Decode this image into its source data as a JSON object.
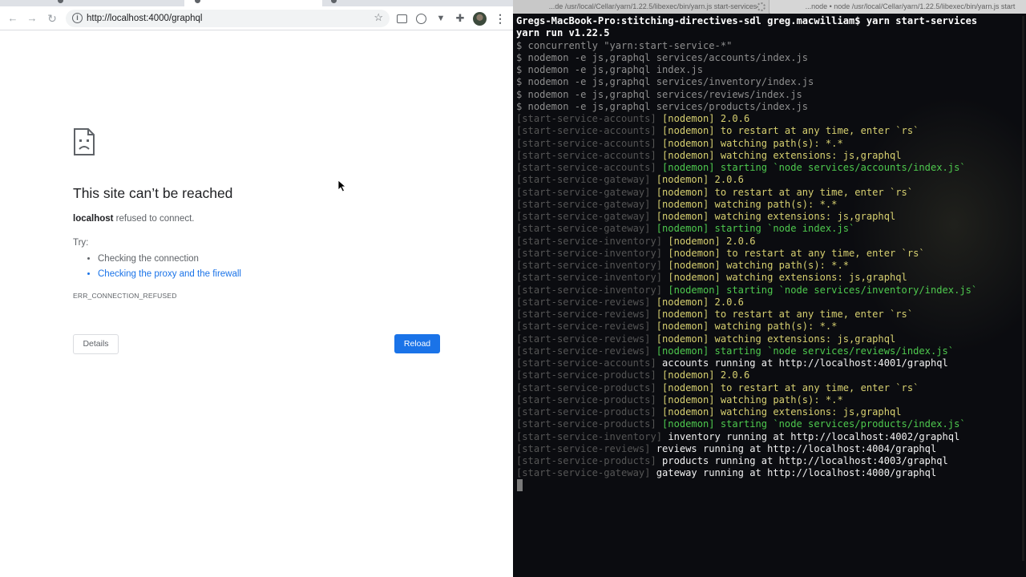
{
  "browser": {
    "address_url": "http://localhost:4000/graphql",
    "icons": [
      "back-arrow-icon",
      "forward-arrow-icon",
      "reload-icon",
      "info-icon",
      "star-icon",
      "extension-icon",
      "vpn-icon",
      "vue-devtools-icon",
      "puzzle-icon",
      "avatar",
      "menu-icon"
    ],
    "error": {
      "title": "This site can’t be reached",
      "host": "localhost",
      "message": " refused to connect.",
      "try_label": "Try:",
      "suggestions": [
        "Checking the connection",
        "Checking the proxy and the firewall"
      ],
      "code": "ERR_CONNECTION_REFUSED",
      "details_label": "Details",
      "reload_label": "Reload"
    }
  },
  "terminal": {
    "tabs": [
      "...de /usr/local/Cellar/yarn/1.22.5/libexec/bin/yarn.js start-services",
      "...node • node /usr/local/Cellar/yarn/1.22.5/libexec/bin/yarn.js start"
    ],
    "lines": [
      [
        {
          "t": "Gregs-MacBook-Pro:stitching-directives-sdl greg.macwilliam$ yarn start-services",
          "c": "p-shell"
        }
      ],
      [
        {
          "t": "yarn run v1.22.5",
          "c": "p-shell"
        }
      ],
      [
        {
          "t": "$ concurrently \"yarn:start-service-*\"",
          "c": "p-cmd"
        }
      ],
      [
        {
          "t": "$ nodemon -e js,graphql services/accounts/index.js",
          "c": "p-cmd"
        }
      ],
      [
        {
          "t": "$ nodemon -e js,graphql index.js",
          "c": "p-cmd"
        }
      ],
      [
        {
          "t": "$ nodemon -e js,graphql services/inventory/index.js",
          "c": "p-cmd"
        }
      ],
      [
        {
          "t": "$ nodemon -e js,graphql services/reviews/index.js",
          "c": "p-cmd"
        }
      ],
      [
        {
          "t": "$ nodemon -e js,graphql services/products/index.js",
          "c": "p-cmd"
        }
      ],
      [
        {
          "t": "[start-service-accounts] ",
          "c": "p-pre"
        },
        {
          "t": "[nodemon] 2.0.6",
          "c": "p-yel"
        }
      ],
      [
        {
          "t": "[start-service-accounts] ",
          "c": "p-pre"
        },
        {
          "t": "[nodemon] to restart at any time, enter `rs`",
          "c": "p-yel"
        }
      ],
      [
        {
          "t": "[start-service-accounts] ",
          "c": "p-pre"
        },
        {
          "t": "[nodemon] watching path(s): *.*",
          "c": "p-yel"
        }
      ],
      [
        {
          "t": "[start-service-accounts] ",
          "c": "p-pre"
        },
        {
          "t": "[nodemon] watching extensions: js,graphql",
          "c": "p-yel"
        }
      ],
      [
        {
          "t": "[start-service-accounts] ",
          "c": "p-pre"
        },
        {
          "t": "[nodemon] starting `node services/accounts/index.js`",
          "c": "p-grn"
        }
      ],
      [
        {
          "t": "[start-service-gateway] ",
          "c": "p-pre"
        },
        {
          "t": "[nodemon] 2.0.6",
          "c": "p-yel"
        }
      ],
      [
        {
          "t": "[start-service-gateway] ",
          "c": "p-pre"
        },
        {
          "t": "[nodemon] to restart at any time, enter `rs`",
          "c": "p-yel"
        }
      ],
      [
        {
          "t": "[start-service-gateway] ",
          "c": "p-pre"
        },
        {
          "t": "[nodemon] watching path(s): *.*",
          "c": "p-yel"
        }
      ],
      [
        {
          "t": "[start-service-gateway] ",
          "c": "p-pre"
        },
        {
          "t": "[nodemon] watching extensions: js,graphql",
          "c": "p-yel"
        }
      ],
      [
        {
          "t": "[start-service-gateway] ",
          "c": "p-pre"
        },
        {
          "t": "[nodemon] starting `node index.js`",
          "c": "p-grn"
        }
      ],
      [
        {
          "t": "[start-service-inventory] ",
          "c": "p-pre"
        },
        {
          "t": "[nodemon] 2.0.6",
          "c": "p-yel"
        }
      ],
      [
        {
          "t": "[start-service-inventory] ",
          "c": "p-pre"
        },
        {
          "t": "[nodemon] to restart at any time, enter `rs`",
          "c": "p-yel"
        }
      ],
      [
        {
          "t": "[start-service-inventory] ",
          "c": "p-pre"
        },
        {
          "t": "[nodemon] watching path(s): *.*",
          "c": "p-yel"
        }
      ],
      [
        {
          "t": "[start-service-inventory] ",
          "c": "p-pre"
        },
        {
          "t": "[nodemon] watching extensions: js,graphql",
          "c": "p-yel"
        }
      ],
      [
        {
          "t": "[start-service-inventory] ",
          "c": "p-pre"
        },
        {
          "t": "[nodemon] starting `node services/inventory/index.js`",
          "c": "p-grn"
        }
      ],
      [
        {
          "t": "[start-service-reviews] ",
          "c": "p-pre"
        },
        {
          "t": "[nodemon] 2.0.6",
          "c": "p-yel"
        }
      ],
      [
        {
          "t": "[start-service-reviews] ",
          "c": "p-pre"
        },
        {
          "t": "[nodemon] to restart at any time, enter `rs`",
          "c": "p-yel"
        }
      ],
      [
        {
          "t": "[start-service-reviews] ",
          "c": "p-pre"
        },
        {
          "t": "[nodemon] watching path(s): *.*",
          "c": "p-yel"
        }
      ],
      [
        {
          "t": "[start-service-reviews] ",
          "c": "p-pre"
        },
        {
          "t": "[nodemon] watching extensions: js,graphql",
          "c": "p-yel"
        }
      ],
      [
        {
          "t": "[start-service-reviews] ",
          "c": "p-pre"
        },
        {
          "t": "[nodemon] starting `node services/reviews/index.js`",
          "c": "p-grn"
        }
      ],
      [
        {
          "t": "[start-service-accounts] ",
          "c": "p-pre"
        },
        {
          "t": "accounts running at http://localhost:4001/graphql",
          "c": "p-wht"
        }
      ],
      [
        {
          "t": "[start-service-products] ",
          "c": "p-pre"
        },
        {
          "t": "[nodemon] 2.0.6",
          "c": "p-yel"
        }
      ],
      [
        {
          "t": "[start-service-products] ",
          "c": "p-pre"
        },
        {
          "t": "[nodemon] to restart at any time, enter `rs`",
          "c": "p-yel"
        }
      ],
      [
        {
          "t": "[start-service-products] ",
          "c": "p-pre"
        },
        {
          "t": "[nodemon] watching path(s): *.*",
          "c": "p-yel"
        }
      ],
      [
        {
          "t": "[start-service-products] ",
          "c": "p-pre"
        },
        {
          "t": "[nodemon] watching extensions: js,graphql",
          "c": "p-yel"
        }
      ],
      [
        {
          "t": "[start-service-products] ",
          "c": "p-pre"
        },
        {
          "t": "[nodemon] starting `node services/products/index.js`",
          "c": "p-grn"
        }
      ],
      [
        {
          "t": "[start-service-inventory] ",
          "c": "p-pre"
        },
        {
          "t": "inventory running at http://localhost:4002/graphql",
          "c": "p-wht"
        }
      ],
      [
        {
          "t": "[start-service-reviews] ",
          "c": "p-pre"
        },
        {
          "t": "reviews running at http://localhost:4004/graphql",
          "c": "p-wht"
        }
      ],
      [
        {
          "t": "[start-service-products] ",
          "c": "p-pre"
        },
        {
          "t": "products running at http://localhost:4003/graphql",
          "c": "p-wht"
        }
      ],
      [
        {
          "t": "[start-service-gateway] ",
          "c": "p-pre"
        },
        {
          "t": "gateway running at http://localhost:4000/graphql",
          "c": "p-wht"
        }
      ]
    ]
  }
}
